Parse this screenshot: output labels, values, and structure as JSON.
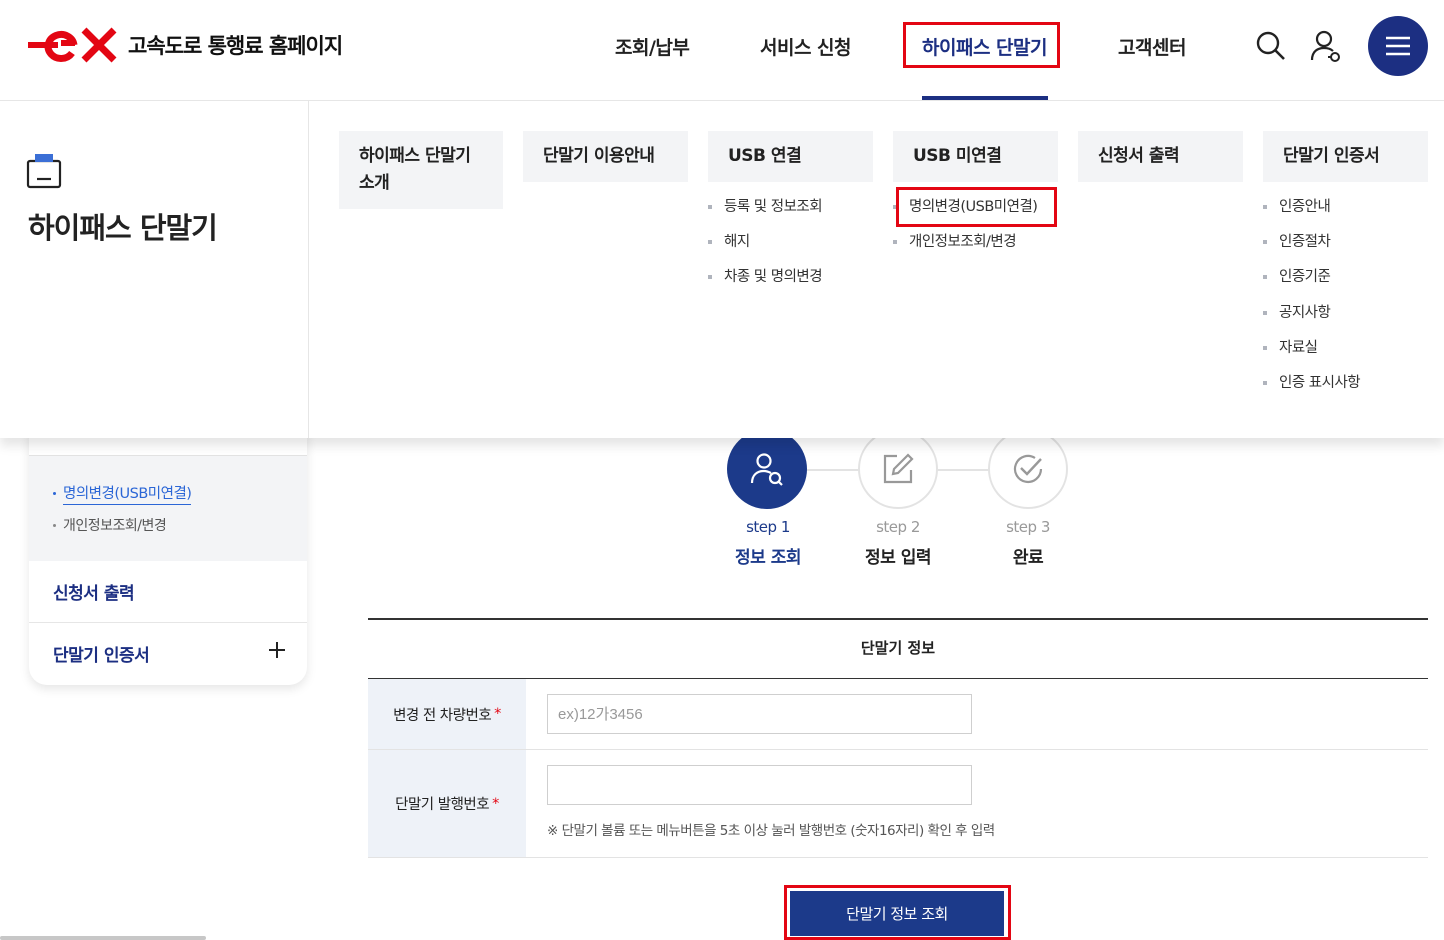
{
  "brand": {
    "logo_text": "고속도로 통행료 홈페이지",
    "color_red": "#e30613",
    "color_navy": "#1c2f82"
  },
  "gnb": {
    "items": [
      {
        "label": "조회/납부"
      },
      {
        "label": "서비스 신청"
      },
      {
        "label": "하이패스 단말기",
        "active": true
      },
      {
        "label": "고객센터"
      }
    ],
    "icons": [
      "search-icon",
      "user-icon",
      "menu-icon"
    ]
  },
  "mega": {
    "section_title": "하이패스 단말기",
    "columns": [
      {
        "head": "하이패스 단말기 소개",
        "items": []
      },
      {
        "head": "단말기 이용안내",
        "items": []
      },
      {
        "head": "USB 연결",
        "items": [
          "등록 및 정보조회",
          "해지",
          "차종 및 명의변경"
        ]
      },
      {
        "head": "USB 미연결",
        "items": [
          "명의변경(USB미연결)",
          "개인정보조회/변경"
        ]
      },
      {
        "head": "신청서 출력",
        "items": []
      },
      {
        "head": "단말기 인증서",
        "items": [
          "인증안내",
          "인증절차",
          "인증기준",
          "공지사항",
          "자료실",
          "인증 표시사항"
        ]
      }
    ]
  },
  "sidebar": {
    "sub_items": [
      "명의변경(USB미연결)",
      "개인정보조회/변경"
    ],
    "rows": [
      {
        "label": "신청서 출력"
      },
      {
        "label": "단말기 인증서"
      }
    ]
  },
  "steps": [
    {
      "num": "step 1",
      "name": "정보 조회",
      "active": true
    },
    {
      "num": "step 2",
      "name": "정보 입력",
      "active": false
    },
    {
      "num": "step 3",
      "name": "완료",
      "active": false
    }
  ],
  "form": {
    "title": "단말기 정보",
    "fields": [
      {
        "label": "변경 전 차량번호",
        "required_mark": "*",
        "value": "",
        "placeholder": "ex)12가3456"
      },
      {
        "label": "단말기 발행번호",
        "required_mark": "*",
        "value": "",
        "placeholder": "",
        "hint": "※ 단말기 볼륨 또는 메뉴버튼을 5초 이상 눌러 발행번호 (숫자16자리) 확인 후 입력"
      }
    ],
    "submit_label": "단말기 정보 조회"
  }
}
